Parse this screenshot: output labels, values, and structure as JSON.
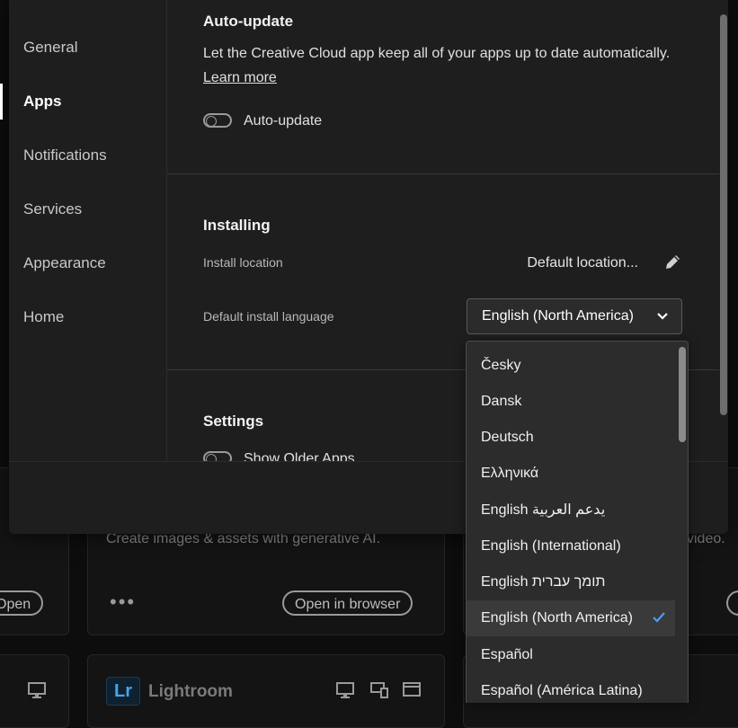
{
  "background": {
    "card1_desc": "Create images & assets with generative AI.",
    "card1_button": "Open in browser",
    "card_left_button": "Open",
    "card_right_desc": "video.",
    "lightroom_logo": "Lr",
    "lightroom_name": "Lightroom",
    "more_dots": "•••"
  },
  "sidebar": {
    "items": [
      {
        "label": "General"
      },
      {
        "label": "Apps"
      },
      {
        "label": "Notifications"
      },
      {
        "label": "Services"
      },
      {
        "label": "Appearance"
      },
      {
        "label": "Home"
      }
    ]
  },
  "auto_update": {
    "title": "Auto-update",
    "description": "Let the Creative Cloud app keep all of your apps up to date automatically.",
    "learn_more": "Learn more",
    "toggle_label": "Auto-update"
  },
  "installing": {
    "title": "Installing",
    "location_label": "Install location",
    "location_value": "Default location...",
    "language_label": "Default install language",
    "language_value": "English (North America)"
  },
  "settings": {
    "title": "Settings",
    "toggle_label": "Show Older Apps"
  },
  "language_options": [
    "Česky",
    "Dansk",
    "Deutsch",
    "Ελληνικά",
    "English يدعم العربية",
    "English (International)",
    "English תומך עברית",
    "English (North America)",
    "Español",
    "Español (América Latina)"
  ],
  "selected_language_index": 7,
  "colors": {
    "accent": "#1473e6",
    "panel": "#1e1e1e",
    "dropdown": "#2c2c2c"
  }
}
